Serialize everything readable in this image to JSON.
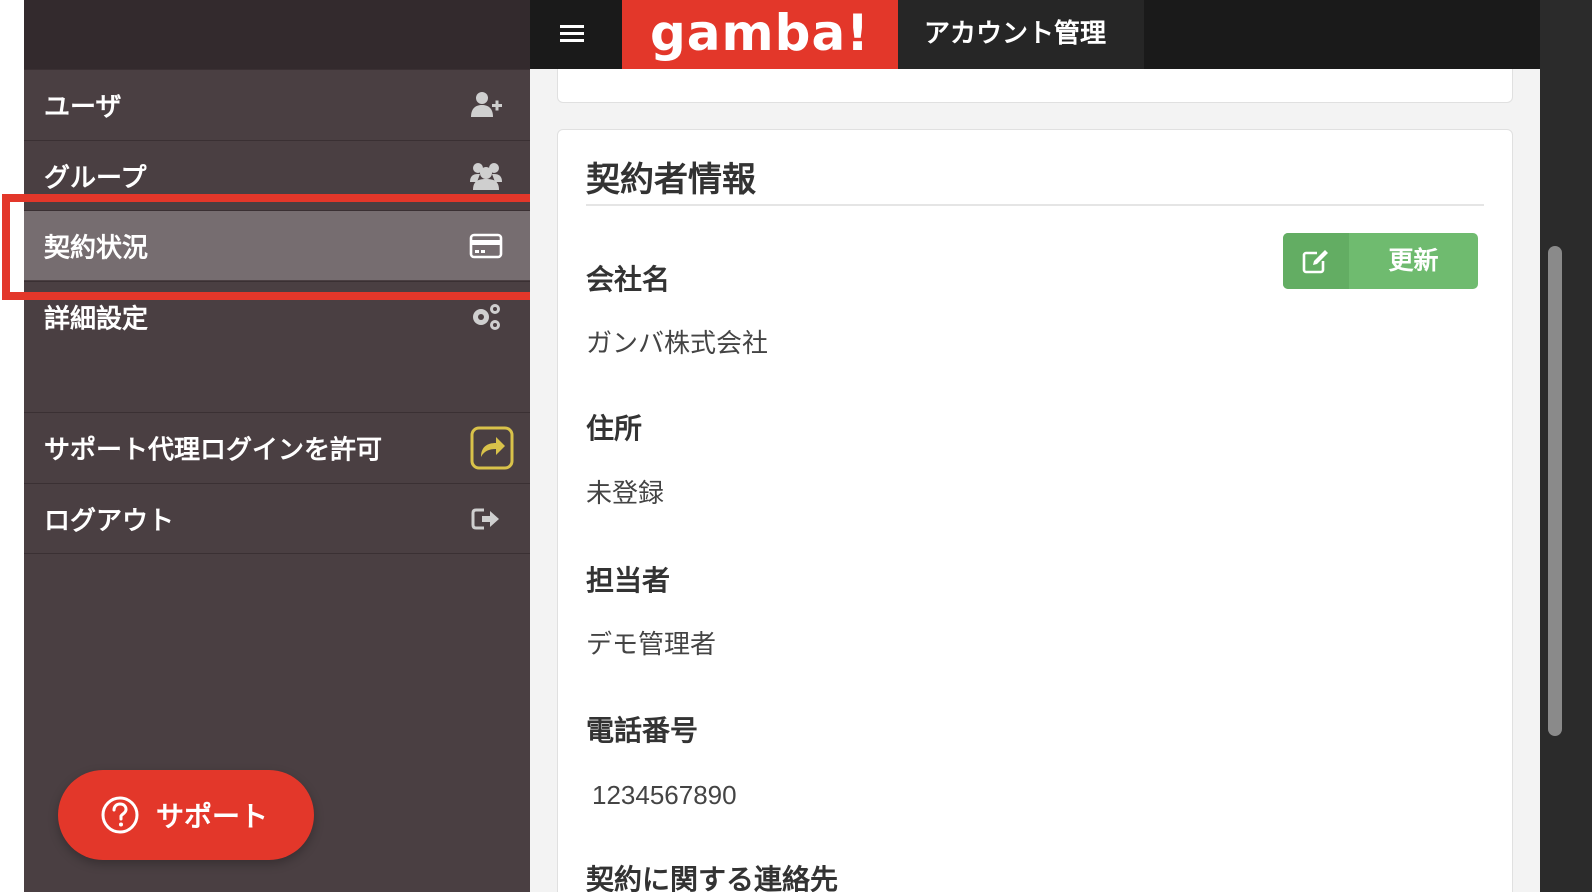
{
  "topbar": {
    "logo_text": "gamba!",
    "title": "アカウント管理"
  },
  "sidebar": {
    "items": [
      {
        "label": "ユーザ",
        "icon": "add-user-icon"
      },
      {
        "label": "グループ",
        "icon": "group-icon"
      },
      {
        "label": "契約状況",
        "icon": "credit-card-icon",
        "active": true
      },
      {
        "label": "詳細設定",
        "icon": "gears-icon"
      },
      {
        "label": "サポート代理ログインを許可",
        "icon": "share-toggle-icon"
      },
      {
        "label": "ログアウト",
        "icon": "sign-out-icon"
      }
    ],
    "support_button": "サポート"
  },
  "card": {
    "title": "契約者情報",
    "update_button": "更新",
    "fields": [
      {
        "label": "会社名",
        "value": "ガンバ株式会社"
      },
      {
        "label": "住所",
        "value": "未登録"
      },
      {
        "label": "担当者",
        "value": "デモ管理者"
      },
      {
        "label": "電話番号",
        "value": "1234567890"
      },
      {
        "label": "契約に関する連絡先",
        "value": ""
      }
    ]
  },
  "colors": {
    "brand_red": "#e3372a",
    "sidebar_bg": "#4a3f42",
    "sidebar_active": "#766d70",
    "update_green": "#6fbb6f",
    "toggle_yellow": "#d9c24a"
  }
}
